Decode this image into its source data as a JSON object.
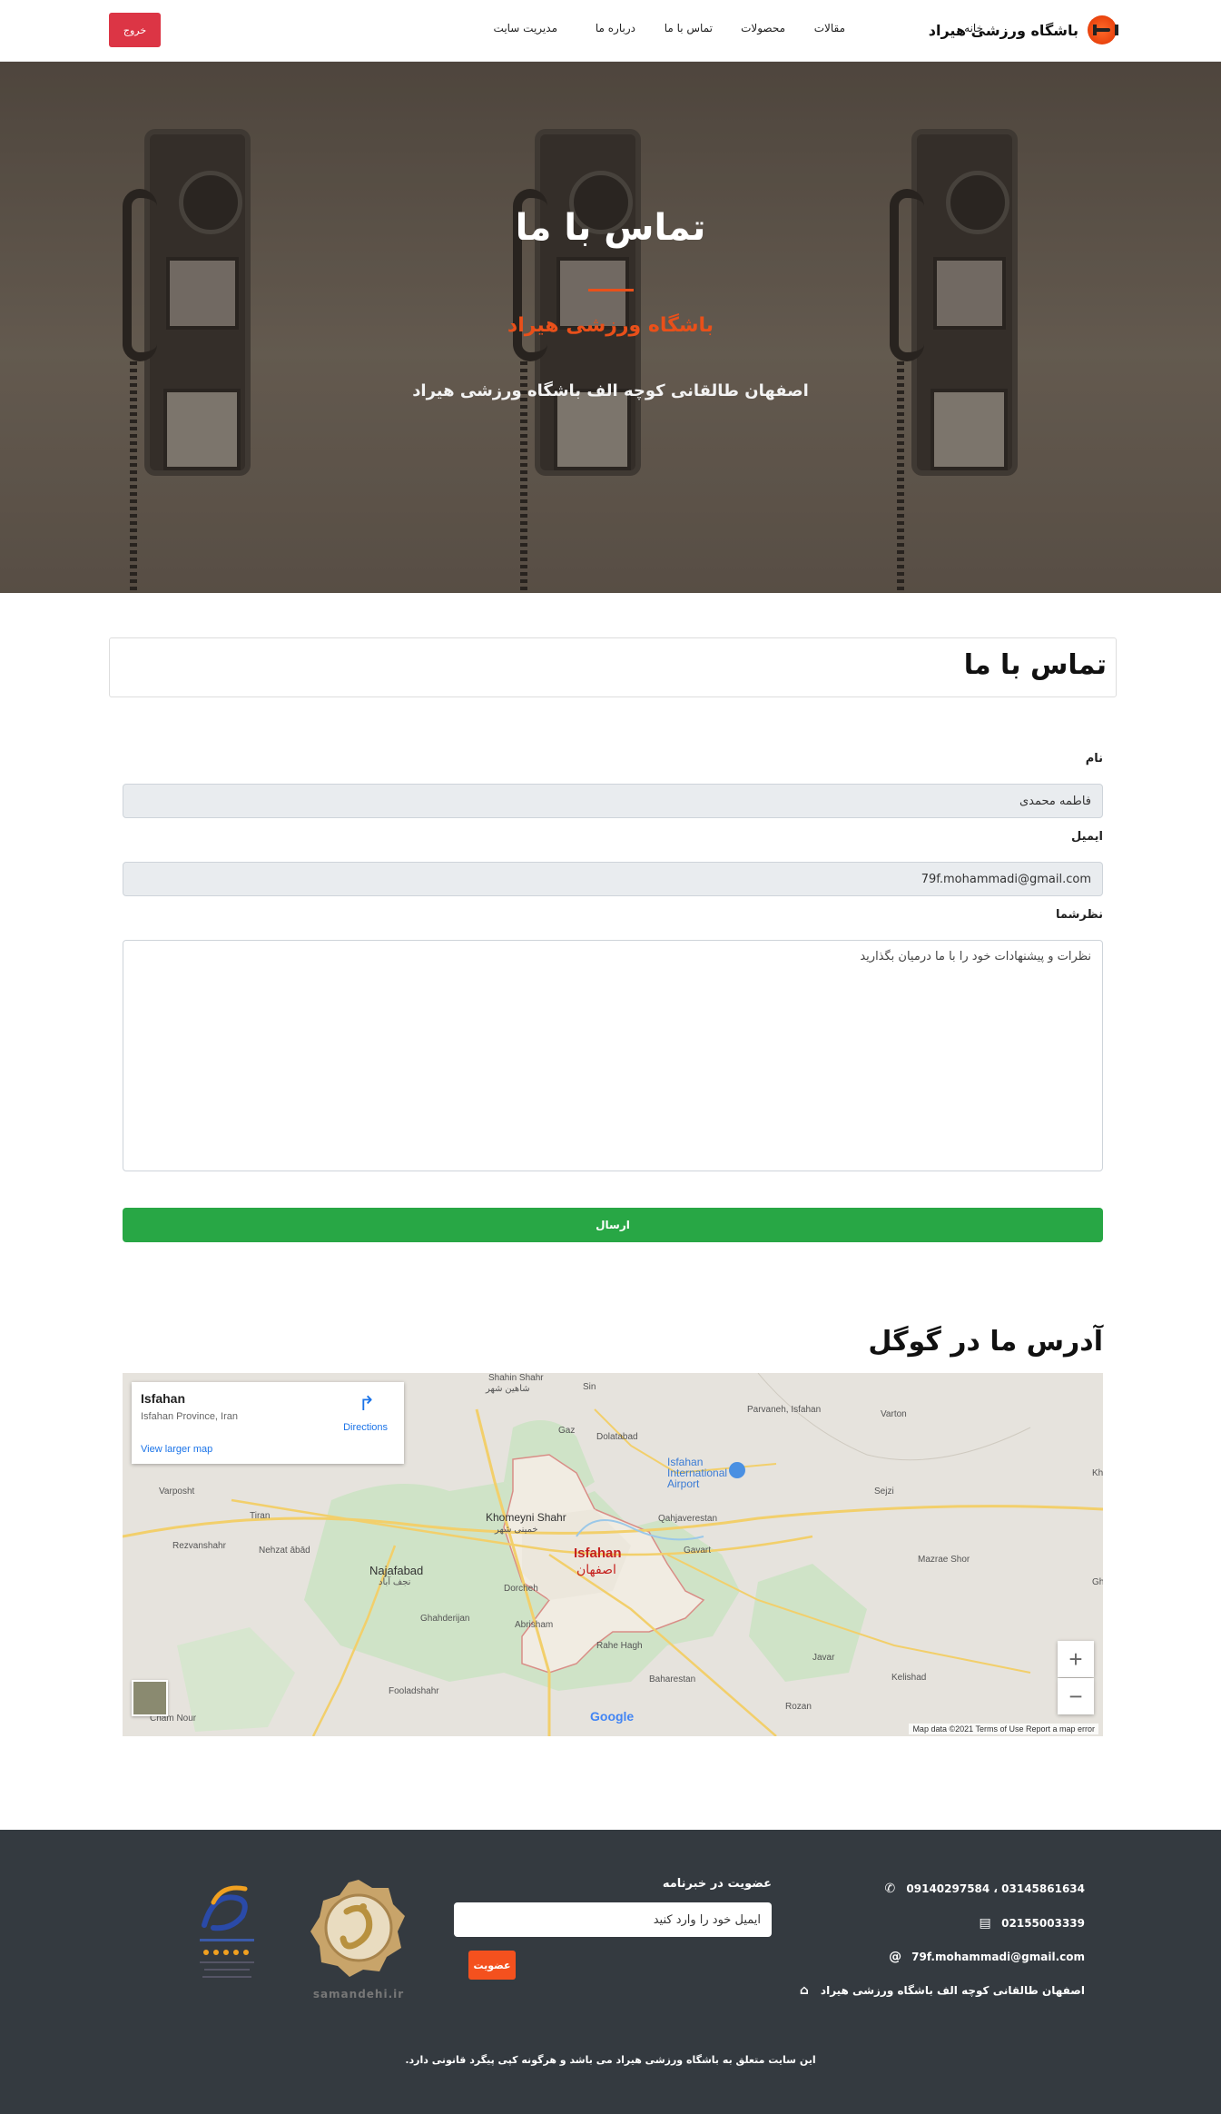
{
  "nav": {
    "brand": "باشگاه ورزشی هیراد",
    "items": [
      "خانه",
      "مقالات",
      "محصولات",
      "تماس با ما",
      "درباره ما",
      "مدیریت سایت"
    ],
    "logout": "خروج"
  },
  "hero": {
    "title": "تماس با ما",
    "subtitle": "باشگاه ورزشی هیراد",
    "address": "اصفهان طالقانی کوچه الف باشگاه ورزشی هیراد"
  },
  "form": {
    "heading": "تماس با ما",
    "name_label": "نام",
    "name_value": "فاطمه محمدی",
    "email_label": "ایمیل",
    "email_value": "79f.mohammadi@gmail.com",
    "comment_label": "نظرشما",
    "comment_placeholder": "نظرات و پیشنهادات خود را با ما درمیان بگذارید",
    "submit": "ارسال"
  },
  "map": {
    "heading": "آدرس ما در گوگل",
    "card_title": "Isfahan",
    "card_subtitle": "Isfahan Province, Iran",
    "directions": "Directions",
    "larger_map": "View larger map",
    "footer": "Map data ©2021    Terms of Use    Report a map error",
    "google": "Google",
    "city": "Isfahan",
    "city_fa": "اصفهان",
    "places": [
      "Shahin Shahr",
      "شاهين شهر",
      "Khomeyni Shahr",
      "خمینی شهر",
      "Najafabad",
      "نجف آباد",
      "Isfahan International Airport",
      "Qahjaverestan",
      "Gavart",
      "Dolatabad",
      "Sin",
      "Gaz",
      "Parvaneh, Isfahan",
      "Varton",
      "Varposht",
      "Tiran",
      "Rezvanshahr",
      "Nehzat ābād",
      "Dorcheh",
      "Ghahderijan",
      "Abrisham",
      "Rahe Hagh",
      "Baharestan",
      "Fooladshahr",
      "Cham Nour",
      "Sejzi",
      "Mazrae Shor",
      "Javar",
      "Kelishad",
      "Rozan",
      "Kh",
      "Gh"
    ]
  },
  "footer": {
    "phones": "09140297584 ، 03145861634",
    "fax": "02155003339",
    "email": "79f.mohammadi@gmail.com",
    "address": "اصفهان طالقانی کوچه الف باشگاه ورزشی هیراد",
    "newsletter_title": "عضویت در خبرنامه",
    "newsletter_placeholder": "ایمیل خود را وارد کنید",
    "newsletter_button": "عضویت",
    "samandehi": "samandehi.ir",
    "copyright": "این سایت متعلق به باشگاه ورزشی هیراد می باشد و هرگونه کپی پیگرد قانونی دارد."
  },
  "colors": {
    "accent": "#e9501a",
    "success": "#28a745",
    "danger": "#dc3545",
    "footer_bg": "#343a40"
  }
}
